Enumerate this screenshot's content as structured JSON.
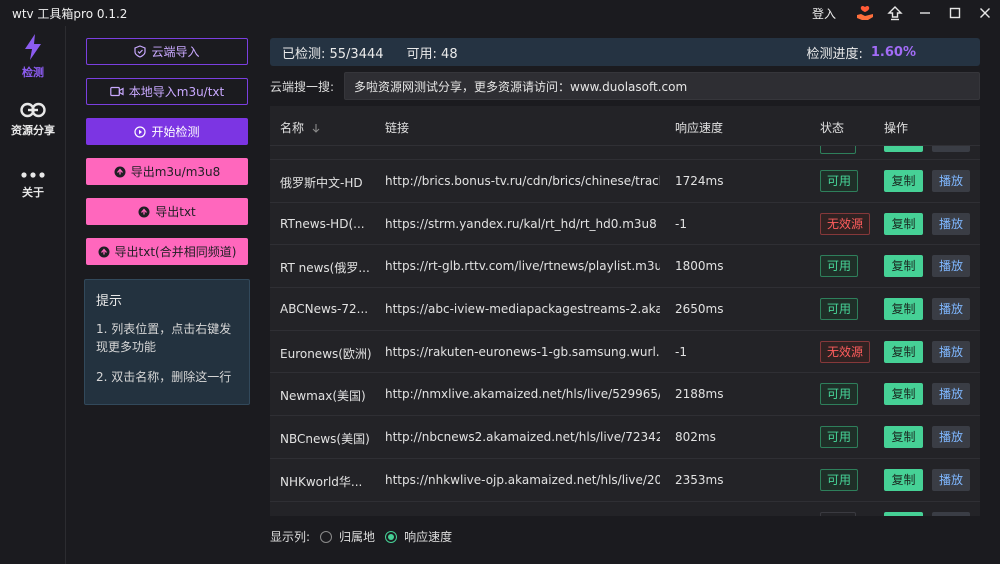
{
  "window": {
    "title": "wtv 工具箱pro 0.1.2",
    "login": "登入"
  },
  "sidebar": {
    "items": [
      {
        "label": "检测",
        "icon": "bolt-icon",
        "active": true
      },
      {
        "label": "资源分享",
        "icon": "link-icon",
        "active": false
      },
      {
        "label": "关于",
        "icon": "more-dots-icon",
        "active": false
      }
    ]
  },
  "actions": {
    "cloud_import": "云端导入",
    "local_import": "本地导入m3u/txt",
    "start_check": "开始检测",
    "export_m3u": "导出m3u/m3u8",
    "export_txt": "导出txt",
    "export_txt_merge": "导出txt(合并相同频道)"
  },
  "tips": {
    "title": "提示",
    "line1": "1. 列表位置，点击右键发现更多功能",
    "line2": "2. 双击名称，删除这一行"
  },
  "status": {
    "checked": "已检测: 55/3444",
    "available": "可用: 48",
    "progress_label": "检测进度:",
    "progress": "1.60%",
    "accent_color": "#a26cf7"
  },
  "search": {
    "label": "云端搜一搜:",
    "value": "多啦资源网测试分享，更多资源请访问：www.duolasoft.com"
  },
  "table": {
    "headers": {
      "name": "名称",
      "url": "链接",
      "speed": "响应速度",
      "status": "状态",
      "ops": "操作"
    },
    "copy_label": "复制",
    "play_label": "播放",
    "rows": [
      {
        "name": "俄罗斯中文-HD",
        "url": "http://brics.bonus-tv.ru/cdn/brics/chinese/tracks...",
        "speed": "1724ms",
        "status": "可用"
      },
      {
        "name": "RTnews-HD(...",
        "url": "https://strm.yandex.ru/kal/rt_hd/rt_hd0.m3u8",
        "speed": "-1",
        "status": "无效源"
      },
      {
        "name": "RT news(俄罗...",
        "url": "https://rt-glb.rttv.com/live/rtnews/playlist.m3u8",
        "speed": "1800ms",
        "status": "可用"
      },
      {
        "name": "ABCNews-72...",
        "url": "https://abc-iview-mediapackagestreams-2.akam...",
        "speed": "2650ms",
        "status": "可用"
      },
      {
        "name": "Euronews(欧洲)",
        "url": "https://rakuten-euronews-1-gb.samsung.wurl.co...",
        "speed": "-1",
        "status": "无效源"
      },
      {
        "name": "Newmax(美国)",
        "url": "http://nmxlive.akamaized.net/hls/live/529965/Li...",
        "speed": "2188ms",
        "status": "可用"
      },
      {
        "name": "NBCnews(美国)",
        "url": "http://nbcnews2.akamaized.net/hls/live/723426...",
        "speed": "802ms",
        "status": "可用"
      },
      {
        "name": "NHKworld华...",
        "url": "https://nhkwlive-ojp.akamaized.net/hls/live/200...",
        "speed": "2353ms",
        "status": "可用"
      }
    ]
  },
  "footer": {
    "label": "显示列:",
    "opt1": "归属地",
    "opt2": "响应速度",
    "selected": "响应速度"
  }
}
